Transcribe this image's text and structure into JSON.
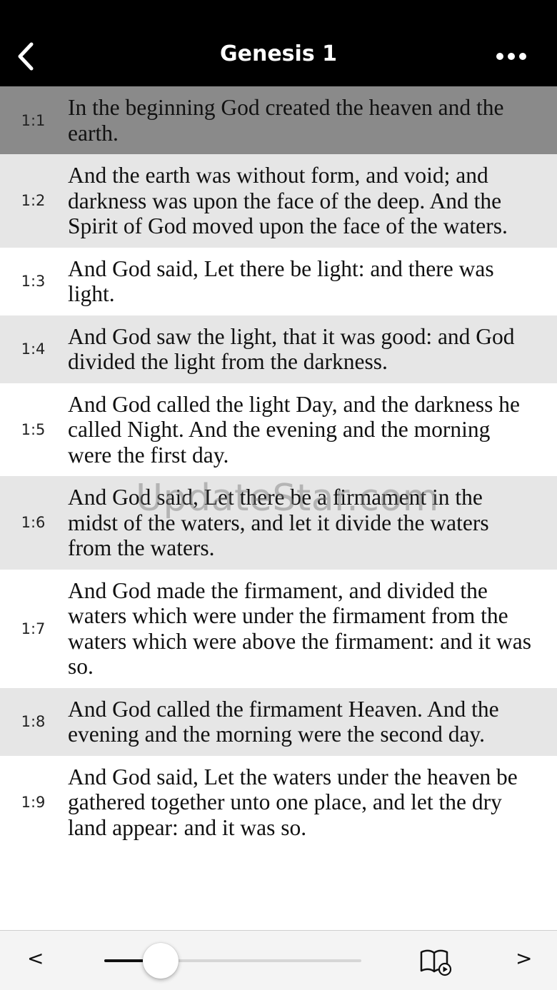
{
  "header": {
    "title": "Genesis 1",
    "back_icon": "chevron-left-icon",
    "more_icon": "ellipsis-icon"
  },
  "verses": [
    {
      "num": "1:1",
      "text": "In the beginning God created the heaven and the earth.",
      "style": "selected"
    },
    {
      "num": "1:2",
      "text": "And the earth was without form, and void; and darkness was upon the face of the deep. And the Spirit of God moved upon the face of the waters.",
      "style": "shade"
    },
    {
      "num": "1:3",
      "text": "And God said, Let there be light: and there was light.",
      "style": "white"
    },
    {
      "num": "1:4",
      "text": "And God saw the light, that it was good: and God divided the light from the darkness.",
      "style": "shade"
    },
    {
      "num": "1:5",
      "text": "And God called the light Day, and the darkness he called Night. And the evening and the morning were the first day.",
      "style": "white"
    },
    {
      "num": "1:6",
      "text": "And God said, Let there be a firmament in the midst of the waters, and let it divide the waters from the waters.",
      "style": "shade"
    },
    {
      "num": "1:7",
      "text": "And God made the firmament, and divided the waters which were under the firmament from the waters which were above the firmament: and it was so.",
      "style": "white"
    },
    {
      "num": "1:8",
      "text": "And God called the firmament Heaven. And the evening and the morning were the second day.",
      "style": "shade"
    },
    {
      "num": "1:9",
      "text": "And God said, Let the waters under the heaven be gathered together unto one place, and let the dry land appear: and it was so.",
      "style": "white"
    }
  ],
  "watermark": "UpdateStar.com",
  "toolbar": {
    "prev_label": "<",
    "next_label": ">",
    "slider_fraction": 0.18,
    "audio_icon": "book-play-icon"
  },
  "colors": {
    "navbar_bg": "#000000",
    "selected_row": "#8a8a8a",
    "shaded_row": "#e6e6e6",
    "toolbar_bg": "#f4f4f4"
  }
}
